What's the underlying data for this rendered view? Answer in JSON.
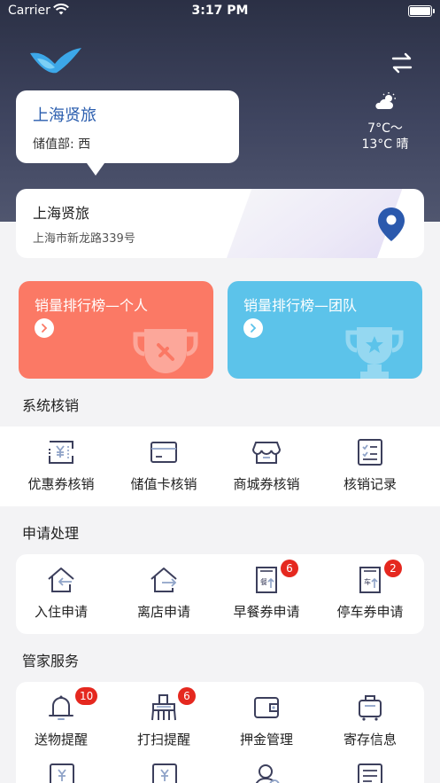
{
  "status_bar": {
    "carrier": "Carrier",
    "time": "3:17 PM"
  },
  "hotel": {
    "name": "上海贤旅",
    "department": "储值部: 西"
  },
  "weather": {
    "temp_line1": "7°C～",
    "temp_line2": "13°C 晴",
    "icon": "partly-cloudy-icon"
  },
  "address": {
    "name": "上海贤旅",
    "detail": "上海市新龙路339号"
  },
  "rankings": {
    "person": "销量排行榜—个人",
    "team": "销量排行榜—团队"
  },
  "sections": {
    "verify": {
      "title": "系统核销",
      "items": [
        {
          "label": "优惠券核销",
          "icon": "coupon-icon"
        },
        {
          "label": "储值卡核销",
          "icon": "card-icon"
        },
        {
          "label": "商城券核销",
          "icon": "shop-icon"
        },
        {
          "label": "核销记录",
          "icon": "record-icon"
        }
      ]
    },
    "apply": {
      "title": "申请处理",
      "items": [
        {
          "label": "入住申请",
          "icon": "checkin-icon",
          "badge": ""
        },
        {
          "label": "离店申请",
          "icon": "checkout-icon",
          "badge": ""
        },
        {
          "label": "早餐券申请",
          "icon": "breakfast-icon",
          "badge": "6"
        },
        {
          "label": "停车券申请",
          "icon": "parking-icon",
          "badge": "2"
        }
      ]
    },
    "butler": {
      "title": "管家服务",
      "items": [
        {
          "label": "送物提醒",
          "icon": "bell-icon",
          "badge": "10"
        },
        {
          "label": "打扫提醒",
          "icon": "broom-icon",
          "badge": "6"
        },
        {
          "label": "押金管理",
          "icon": "wallet-icon",
          "badge": ""
        },
        {
          "label": "寄存信息",
          "icon": "luggage-icon",
          "badge": ""
        }
      ]
    }
  },
  "colors": {
    "header": "#3f4560",
    "person_card": "#fb7965",
    "team_card": "#5cc3ea",
    "badge": "#e5281f",
    "icon_stroke": "#3c3f5c",
    "icon_accent": "#8fa3c8"
  }
}
